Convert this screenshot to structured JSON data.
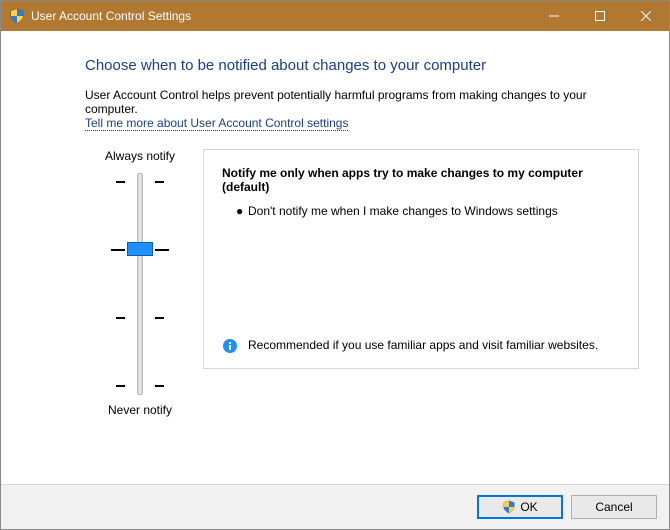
{
  "window": {
    "title": "User Account Control Settings"
  },
  "heading": "Choose when to be notified about changes to your computer",
  "intro": "User Account Control helps prevent potentially harmful programs from making changes to your computer.",
  "help_link": "Tell me more about User Account Control settings",
  "slider": {
    "top_label": "Always notify",
    "bottom_label": "Never notify",
    "levels": 4,
    "selected_index": 1
  },
  "panel": {
    "title": "Notify me only when apps try to make changes to my computer (default)",
    "bullet": "Don't notify me when I make changes to Windows settings",
    "recommendation": "Recommended if you use familiar apps and visit familiar websites."
  },
  "buttons": {
    "ok": "OK",
    "cancel": "Cancel"
  }
}
